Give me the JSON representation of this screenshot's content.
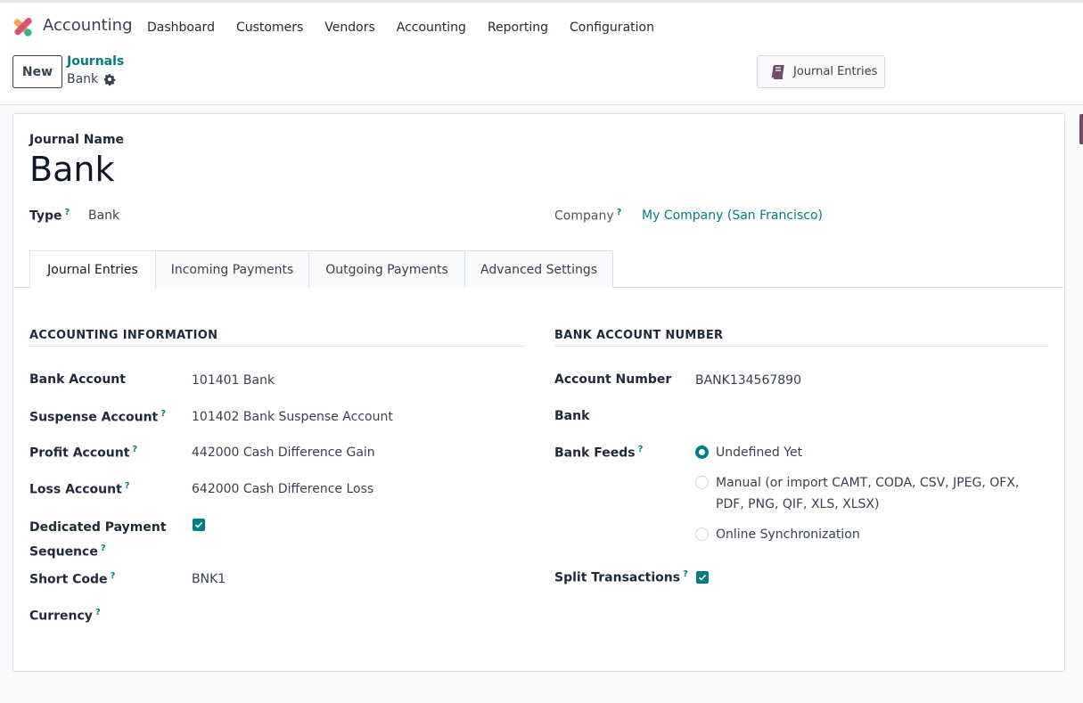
{
  "app": {
    "name": "Accounting"
  },
  "menu": {
    "items": [
      {
        "label": "Dashboard"
      },
      {
        "label": "Customers"
      },
      {
        "label": "Vendors"
      },
      {
        "label": "Accounting"
      },
      {
        "label": "Reporting"
      },
      {
        "label": "Configuration"
      }
    ]
  },
  "control_panel": {
    "new_label": "New",
    "breadcrumb_parent": "Journals",
    "breadcrumb_current": "Bank",
    "smart_button_label": "Journal Entries"
  },
  "form": {
    "journal_name_label": "Journal Name",
    "journal_name": "Bank",
    "type_label": "Type",
    "type_value": "Bank",
    "company_label": "Company",
    "company_value": "My Company (San Francisco)",
    "help_mark": "?"
  },
  "tabs": [
    {
      "label": "Journal Entries",
      "active": true
    },
    {
      "label": "Incoming Payments",
      "active": false
    },
    {
      "label": "Outgoing Payments",
      "active": false
    },
    {
      "label": "Advanced Settings",
      "active": false
    }
  ],
  "accounting_info": {
    "title": "ACCOUNTING INFORMATION",
    "bank_account_label": "Bank Account",
    "bank_account_value": "101401 Bank",
    "suspense_label": "Suspense Account",
    "suspense_value": "101402 Bank Suspense Account",
    "profit_label": "Profit Account",
    "profit_value": "442000 Cash Difference Gain",
    "loss_label": "Loss Account",
    "loss_value": "642000 Cash Difference Loss",
    "dedicated_label_line1": "Dedicated Payment",
    "dedicated_label_line2": "Sequence",
    "dedicated_checked": true,
    "short_code_label": "Short Code",
    "short_code_value": "BNK1",
    "currency_label": "Currency",
    "currency_value": ""
  },
  "bank_account": {
    "title": "BANK ACCOUNT NUMBER",
    "account_number_label": "Account Number",
    "account_number_value": "BANK134567890",
    "bank_label": "Bank",
    "bank_value": "",
    "feeds_label": "Bank Feeds",
    "feeds_options": [
      {
        "label": "Undefined Yet",
        "checked": true
      },
      {
        "label_line1": "Manual (or import CAMT, CODA, CSV, JPEG, OFX,",
        "label_line2": "PDF, PNG, QIF, XLS, XLSX)",
        "checked": false
      },
      {
        "label": "Online Synchronization",
        "checked": false
      }
    ],
    "split_label": "Split Transactions",
    "split_checked": true
  },
  "colors": {
    "accent": "#017e84",
    "brand": "#714b67"
  }
}
